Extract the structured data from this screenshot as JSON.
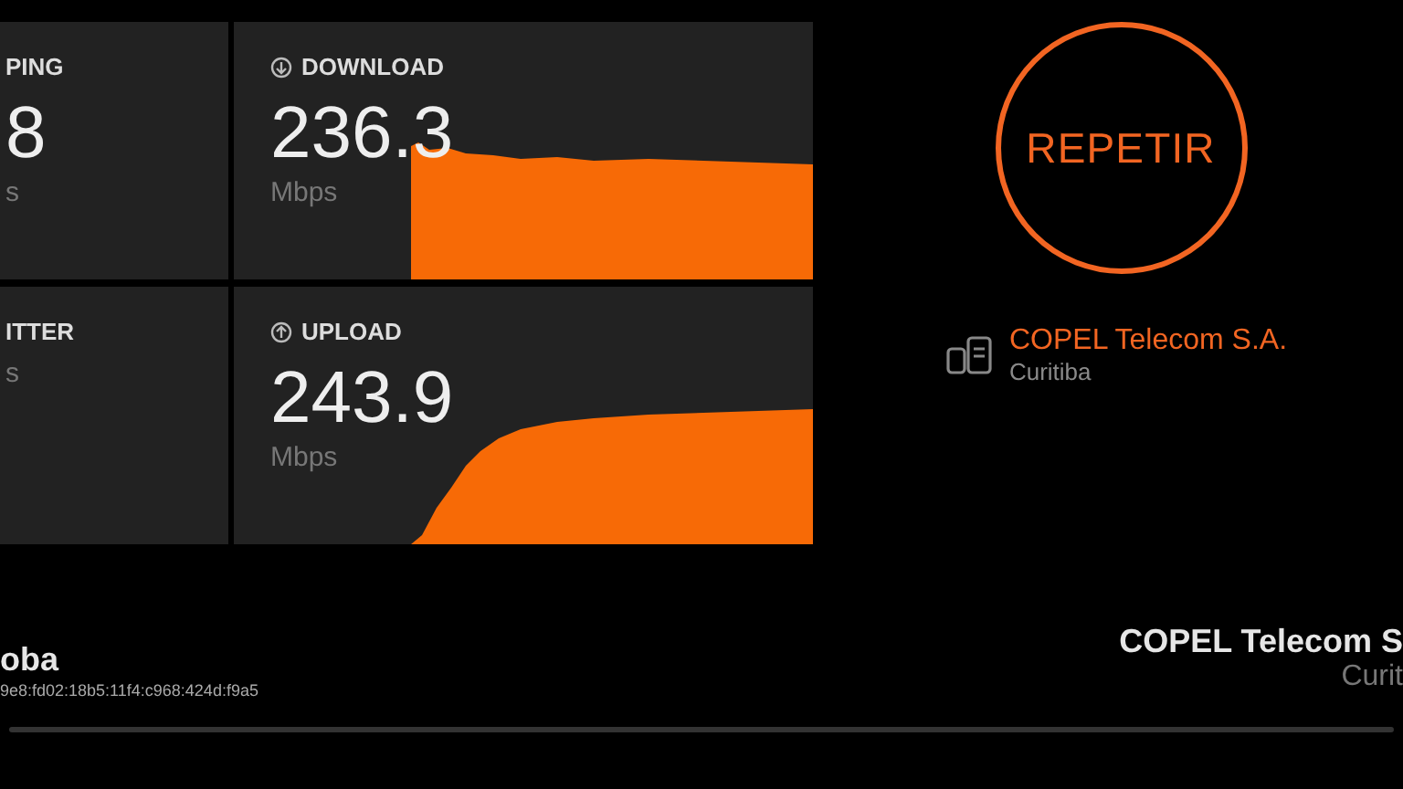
{
  "metrics": [
    {
      "kind": "partial",
      "label": "PING",
      "value": "8",
      "unit": "s"
    },
    {
      "kind": "download",
      "label": "DOWNLOAD",
      "value": "236.3",
      "unit": "Mbps"
    },
    {
      "kind": "partial",
      "label": "ITTER",
      "unit": "s"
    },
    {
      "kind": "upload",
      "label": "UPLOAD",
      "value": "243.9",
      "unit": "Mbps"
    }
  ],
  "again_button": {
    "label": "REPETIR"
  },
  "provider": {
    "name": "COPEL Telecom S.A.",
    "location": "Curitiba"
  },
  "footer": {
    "left_title": "oba",
    "address": "9e8:fd02:18b5:11f4:c968:424d:f9a5",
    "right_title": "COPEL Telecom S",
    "right_location": "Curit"
  }
}
